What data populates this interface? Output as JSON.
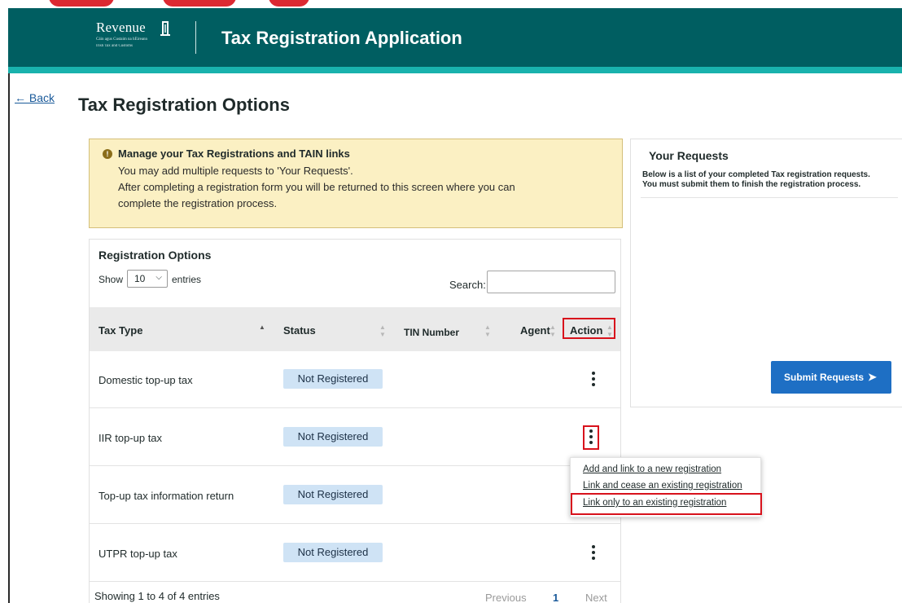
{
  "header": {
    "logo_text": "Revenue",
    "logo_subtext_1": "Cáin agus Custaim na hÉireann",
    "logo_subtext_2": "Irish Tax and Customs",
    "app_title": "Tax Registration Application"
  },
  "nav": {
    "back_label": "← Back"
  },
  "page": {
    "title": "Tax Registration Options"
  },
  "notice": {
    "title": "Manage your Tax Registrations and TAIN links",
    "lines": [
      "You may add multiple requests to 'Your Requests'.",
      "After completing a registration form you will be returned to this screen where you can",
      "complete the registration process."
    ]
  },
  "registration": {
    "title": "Registration Options",
    "show_label": "Show",
    "entries_value": "10",
    "entries_label": "entries",
    "search_label": "Search:",
    "search_value": "",
    "columns": [
      "Tax Type",
      "Status",
      "TIN Number",
      "Agent",
      "Action"
    ],
    "rows": [
      {
        "tax_type": "Domestic top-up tax",
        "status": "Not Registered"
      },
      {
        "tax_type": "IIR top-up tax",
        "status": "Not Registered"
      },
      {
        "tax_type": "Top-up tax information return",
        "status": "Not Registered"
      },
      {
        "tax_type": "UTPR top-up tax",
        "status": "Not Registered"
      }
    ],
    "footer": {
      "showing": "Showing 1 to 4 of 4 entries",
      "previous": "Previous",
      "page": "1",
      "next": "Next"
    }
  },
  "action_menu": {
    "items": [
      "Add and link to a new registration",
      "Link and cease an existing registration",
      "Link only to an existing registration"
    ],
    "highlighted_index": 2
  },
  "requests": {
    "title": "Your Requests",
    "line_1": "Below is a list of your completed Tax registration requests.",
    "line_2": "You must submit them to finish the registration process.",
    "submit_label": "Submit Requests"
  },
  "colors": {
    "header_bg": "#005e61",
    "header_accent": "#19b2ad",
    "notice_bg": "#fbf0c3",
    "badge_bg": "#cfe3f5",
    "button_bg": "#1e6fc4",
    "annotation_red": "#d8121c"
  },
  "icons": {
    "notice": "info-circle-icon",
    "sort": "sort-arrows-icon",
    "action": "kebab-menu-icon",
    "submit": "send-arrow-icon",
    "select": "chevron-down-icon"
  }
}
